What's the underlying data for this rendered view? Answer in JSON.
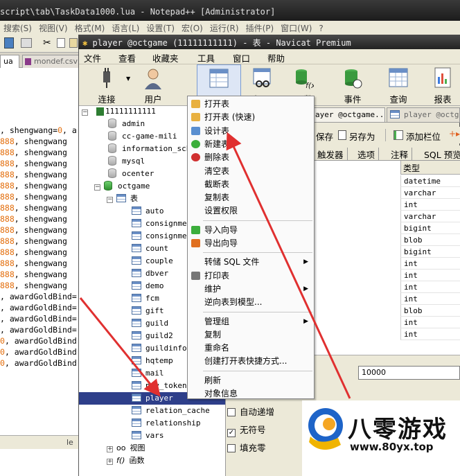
{
  "npp": {
    "title": "script\\tab\\TaskData1000.lua - Notepad++ [Administrator]",
    "menu": [
      "搜索(S)",
      "视图(V)",
      "格式(M)",
      "语言(L)",
      "设置(T)",
      "宏(O)",
      "运行(R)",
      "插件(P)",
      "窗口(W)",
      "?"
    ],
    "tabs": [
      "ua",
      "mondef.csv"
    ],
    "code_lines": [
      {
        "pre": ", shengwang=",
        "num": "0",
        "post": ", a"
      },
      {
        "pre": "",
        "num": "888",
        "post": ",   shengwang"
      },
      {
        "pre": "",
        "num": "888",
        "post": ",   shengwang"
      },
      {
        "pre": "",
        "num": "888",
        "post": ",   shengwang"
      },
      {
        "pre": "",
        "num": "888",
        "post": ",   shengwang"
      },
      {
        "pre": "",
        "num": "888",
        "post": ",   shengwang"
      },
      {
        "pre": "",
        "num": "888",
        "post": ",   shengwang"
      },
      {
        "pre": "",
        "num": "888",
        "post": ",   shengwang"
      },
      {
        "pre": "",
        "num": "888",
        "post": ",   shengwang"
      },
      {
        "pre": "",
        "num": "888",
        "post": ",   shengwang"
      },
      {
        "pre": "",
        "num": "888",
        "post": ",   shengwang"
      },
      {
        "pre": "",
        "num": "888",
        "post": ",   shengwang"
      },
      {
        "pre": "",
        "num": "888",
        "post": ",   shengwang"
      },
      {
        "pre": "",
        "num": "888",
        "post": ",   shengwang"
      },
      {
        "pre": "",
        "num": "888",
        "post": ",   shengwang"
      },
      {
        "pre": ", awardGoldBind=",
        "num": "",
        "post": ""
      },
      {
        "pre": ", awardGoldBind=",
        "num": "",
        "post": ""
      },
      {
        "pre": ", awardGoldBind=",
        "num": "",
        "post": ""
      },
      {
        "pre": ", awardGoldBind=",
        "num": "",
        "post": ""
      },
      {
        "pre": "",
        "num": "0",
        "post": ", awardGoldBind"
      },
      {
        "pre": "",
        "num": "0",
        "post": ", awardGoldBind"
      },
      {
        "pre": "",
        "num": "0",
        "post": ", awardGoldBind"
      }
    ],
    "status_text": "le"
  },
  "navicat": {
    "title": "player @octgame (11111111111) - 表 - Navicat Premium",
    "menu": [
      "文件",
      "查看",
      "收藏夹",
      "工具",
      "窗口",
      "帮助"
    ],
    "toolbar": {
      "connect": "连接",
      "user": "用户",
      "table": "表",
      "view": "视图",
      "function": "函数",
      "event": "事件",
      "query": "查询",
      "report": "报表"
    },
    "tree": {
      "connection": "11111111111",
      "databases_top": [
        "admin",
        "cc-game-mili",
        "information_schema",
        "mysql",
        "ocenter"
      ],
      "active_db": "octgame",
      "tables_node": "表",
      "tables": [
        "auto",
        "consignment",
        "consignment",
        "count",
        "couple",
        "dbver",
        "demo",
        "fcm",
        "gift",
        "guild",
        "guild2",
        "guildinfo",
        "hqtemp",
        "mail",
        "pay_token",
        "player",
        "relation_cache",
        "relationship",
        "vars"
      ],
      "selected": "player",
      "views_node": "视图",
      "functions_node": "函数"
    },
    "right": {
      "tab1": "ayer @octgame...",
      "tab2": "player @octgame",
      "save": "保存",
      "save_as": "另存为",
      "add_field": "添加栏位",
      "subtabs": [
        "触发器",
        "选项",
        "注释",
        "SQL 预览"
      ],
      "type_header": "类型",
      "types": [
        "datetime",
        "varchar",
        "int",
        "varchar",
        "bigint",
        "blob",
        "bigint",
        "int",
        "int",
        "int",
        "int",
        "blob",
        "int",
        "int"
      ],
      "default_value": "10000",
      "checkboxes": [
        {
          "label": "自动递增",
          "checked": false
        },
        {
          "label": "无符号",
          "checked": true
        },
        {
          "label": "填充零",
          "checked": false
        }
      ]
    }
  },
  "context_menu": {
    "items": [
      {
        "label": "打开表",
        "icon": "open-table-icon",
        "sub": false
      },
      {
        "label": "打开表 (快速)",
        "icon": "open-table-fast-icon",
        "sub": false
      },
      {
        "label": "设计表",
        "icon": "design-table-icon",
        "sub": false
      },
      {
        "label": "新建表",
        "icon": "new-table-icon",
        "sub": false
      },
      {
        "label": "删除表",
        "icon": "delete-table-icon",
        "sub": false
      },
      {
        "label": "清空表",
        "icon": "",
        "sub": false
      },
      {
        "label": "截断表",
        "icon": "",
        "sub": false
      },
      {
        "label": "复制表",
        "icon": "",
        "sub": false
      },
      {
        "label": "设置权限",
        "icon": "",
        "sub": false
      },
      {
        "label": "导入向导",
        "icon": "import-wizard-icon",
        "sub": false
      },
      {
        "label": "导出向导",
        "icon": "export-wizard-icon",
        "sub": false
      },
      {
        "label": "转储 SQL 文件",
        "icon": "",
        "sub": true
      },
      {
        "label": "打印表",
        "icon": "print-icon",
        "sub": false
      },
      {
        "label": "维护",
        "icon": "",
        "sub": true
      },
      {
        "label": "逆向表到模型...",
        "icon": "",
        "sub": false
      },
      {
        "label": "管理组",
        "icon": "",
        "sub": true
      },
      {
        "label": "复制",
        "icon": "",
        "sub": false
      },
      {
        "label": "重命名",
        "icon": "",
        "sub": false
      },
      {
        "label": "创建打开表快捷方式...",
        "icon": "",
        "sub": false
      },
      {
        "label": "刷新",
        "icon": "",
        "sub": false
      },
      {
        "label": "对象信息",
        "icon": "",
        "sub": false
      }
    ]
  },
  "watermark": {
    "name": "八零游戏",
    "url": "www.80yx.top"
  },
  "colors": {
    "accent_red": "#e03030",
    "selection": "#2e3f8a",
    "number_orange": "#e36c09"
  }
}
